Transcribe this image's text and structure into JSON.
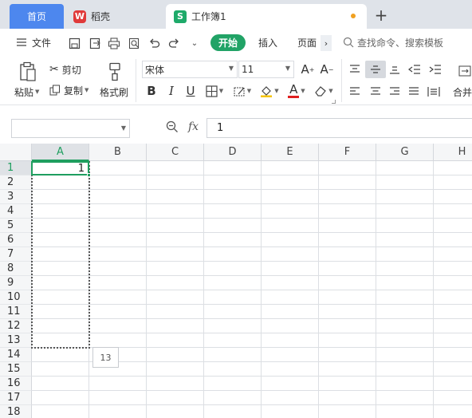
{
  "tabs": {
    "home": "首页",
    "app": "稻壳",
    "doc": "工作簿1",
    "new_tab": "+"
  },
  "menu": {
    "file": "文件",
    "start": "开始",
    "insert": "插入",
    "page": "页面",
    "search": "查找命令、搜索模板"
  },
  "ribbon": {
    "paste": "粘贴",
    "cut": "剪切",
    "copy": "复制",
    "format_painter": "格式刷",
    "font_name": "宋体",
    "font_size": "11",
    "bold": "B",
    "italic": "I",
    "underline": "U",
    "font_color_letter": "A",
    "merge": "合并"
  },
  "formula": {
    "name_box": "",
    "fx": "fx",
    "value": "1"
  },
  "grid": {
    "columns": [
      "A",
      "B",
      "C",
      "D",
      "E",
      "F",
      "G",
      "H"
    ],
    "rows": [
      "1",
      "2",
      "3",
      "4",
      "5",
      "6",
      "7",
      "8",
      "9",
      "10",
      "11",
      "12",
      "13",
      "14",
      "15",
      "16",
      "17",
      "18"
    ],
    "cell_a1": "1",
    "fill_tooltip": "13"
  },
  "colors": {
    "accent_green": "#1f9e5f",
    "home_tab_blue": "#4d87ee"
  }
}
